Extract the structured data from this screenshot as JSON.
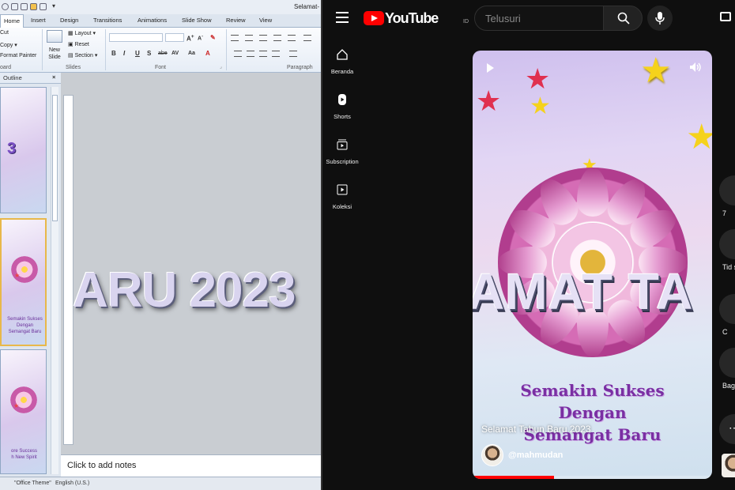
{
  "ppt": {
    "title": "Selamat-",
    "tabs": [
      "Home",
      "Insert",
      "Design",
      "Transitions",
      "Animations",
      "Slide Show",
      "Review",
      "View"
    ],
    "clipboard": {
      "cut": "Cut",
      "copy": "Copy",
      "format_painter": "Format Painter",
      "group": "oard"
    },
    "slides_group": {
      "new_slide": "New Slide",
      "layout": "Layout",
      "reset": "Reset",
      "section": "Section",
      "group": "Slides"
    },
    "font_group": "Font",
    "paragraph_group": "Paragraph",
    "font_buttons": [
      "B",
      "I",
      "U",
      "S",
      "abe",
      "AV",
      "Aa"
    ],
    "pane_tab": "Outline",
    "thumbs": [
      {
        "number": "3"
      },
      {
        "lines": [
          "Semakin Sukses",
          "Dengan",
          "Semangat Baru"
        ]
      },
      {
        "lines": [
          "ore Success",
          "h New Spirit"
        ]
      }
    ],
    "slide_text": "ARU 2023",
    "notes_placeholder": "Click to add notes",
    "status": {
      "theme": "\"Office Theme\"",
      "language": "English (U.S.)"
    }
  },
  "yt": {
    "logo_text": "YouTube",
    "region": "ID",
    "search_placeholder": "Telusuri",
    "nav": [
      {
        "label": "Beranda",
        "icon": "home-icon"
      },
      {
        "label": "Shorts",
        "icon": "shorts-icon"
      },
      {
        "label": "Subscription",
        "icon": "subscriptions-icon"
      },
      {
        "label": "Koleksi",
        "icon": "library-icon"
      }
    ],
    "video": {
      "big_text": "AMAT TA",
      "lines": [
        "Semakin Sukses",
        "Dengan",
        "Semangat Baru"
      ],
      "title": "Selamat Tahun Baru 2023",
      "channel": "@mahmudan",
      "progress": 0.34
    },
    "actions": [
      {
        "name": "like",
        "label": "7"
      },
      {
        "name": "dislike",
        "label": "Tid su"
      },
      {
        "name": "comments",
        "label": "C"
      },
      {
        "name": "share",
        "label": "Bag n"
      },
      {
        "name": "more",
        "label": ""
      }
    ],
    "colors": {
      "brand": "#ff0000",
      "bg": "#0f0f0f"
    }
  }
}
